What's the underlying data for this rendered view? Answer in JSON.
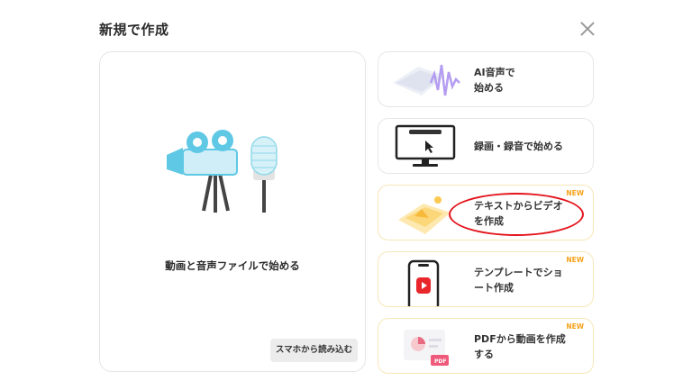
{
  "dialog": {
    "title": "新規で作成"
  },
  "left_card": {
    "label": "動画と音声ファイルで始める",
    "phone_button": "スマホから読み込む"
  },
  "options": [
    {
      "line1": "AI音声で",
      "line2": "始める",
      "is_new": false,
      "icon": "ai-voice-icon"
    },
    {
      "line1": "録画・録音で始める",
      "line2": "",
      "is_new": false,
      "icon": "screen-record-icon"
    },
    {
      "line1": "テキストからビデオ",
      "line2": "を作成",
      "is_new": true,
      "icon": "text-to-video-icon"
    },
    {
      "line1": "テンプレートでショ",
      "line2": "ート作成",
      "is_new": true,
      "icon": "shorts-template-icon"
    },
    {
      "line1": "PDFから動画を作成",
      "line2": "する",
      "is_new": true,
      "icon": "pdf-icon"
    }
  ],
  "badges": {
    "new_label": "NEW"
  },
  "colors": {
    "accent_cyan": "#5ec8e5",
    "new_badge": "#f7a21b",
    "highlight_circle": "#e3141c"
  }
}
